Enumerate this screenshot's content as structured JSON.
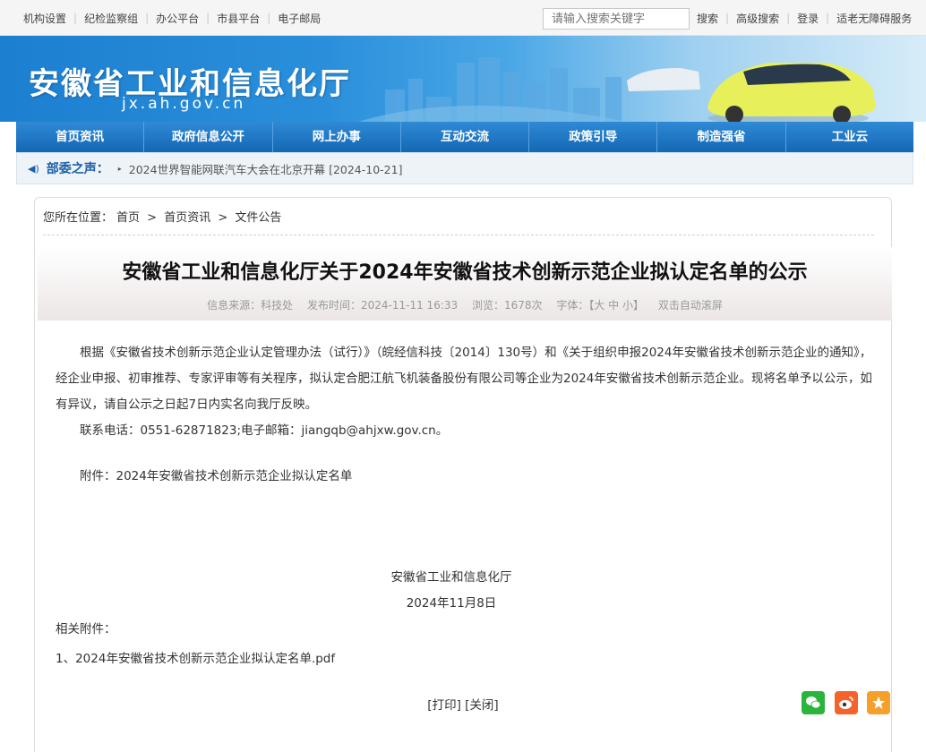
{
  "topbar": {
    "links": [
      "机构设置",
      "纪检监察组",
      "办公平台",
      "市县平台",
      "电子邮局"
    ],
    "search_placeholder": "请输入搜索关键字",
    "right_links": [
      "搜索",
      "高级搜索",
      "登录",
      "适老无障碍服务"
    ]
  },
  "banner": {
    "title": "安徽省工业和信息化厅",
    "domain": "jx.ah.gov.cn"
  },
  "nav": {
    "tabs": [
      "首页资讯",
      "政府信息公开",
      "网上办事",
      "互动交流",
      "政策引导",
      "制造强省",
      "工业云"
    ]
  },
  "notice": {
    "label": "部委之声：",
    "news": "2024世界智能网联汽车大会在北京开幕 [2024-10-21]"
  },
  "breadcrumb": {
    "prefix": "您所在位置：",
    "items": [
      "首页",
      "首页资讯",
      "文件公告"
    ],
    "sep": ">"
  },
  "article": {
    "title": "安徽省工业和信息化厅关于2024年安徽省技术创新示范企业拟认定名单的公示",
    "meta": {
      "source": "信息来源：科技处",
      "time": "发布时间：2024-11-11 16:33",
      "views": "浏览：1678次",
      "font": "字体：【大 中 小】",
      "scroll": "双击自动滚屏"
    },
    "paragraph": "根据《安徽省技术创新示范企业认定管理办法（试行）》（皖经信科技〔2014〕130号）和《关于组织申报2024年安徽省技术创新示范企业的通知》，经企业申报、初审推荐、专家评审等有关程序，拟认定合肥江航飞机装备股份有限公司等企业为2024年安徽省技术创新示范企业。现将名单予以公示，如有异议，请自公示之日起7日内实名向我厅反映。",
    "contact": "联系电话：0551-62871823;电子邮箱：jiangqb@ahjxw.gov.cn。",
    "attachment": "附件：2024年安徽省技术创新示范企业拟认定名单",
    "sign_org": "安徽省工业和信息化厅",
    "sign_date": "2024年11月8日",
    "related_label": "相关附件：",
    "file": "1、2024年安徽省技术创新示范企业拟认定名单.pdf"
  },
  "actions": {
    "print": "[打印]",
    "close": "[关闭]"
  }
}
